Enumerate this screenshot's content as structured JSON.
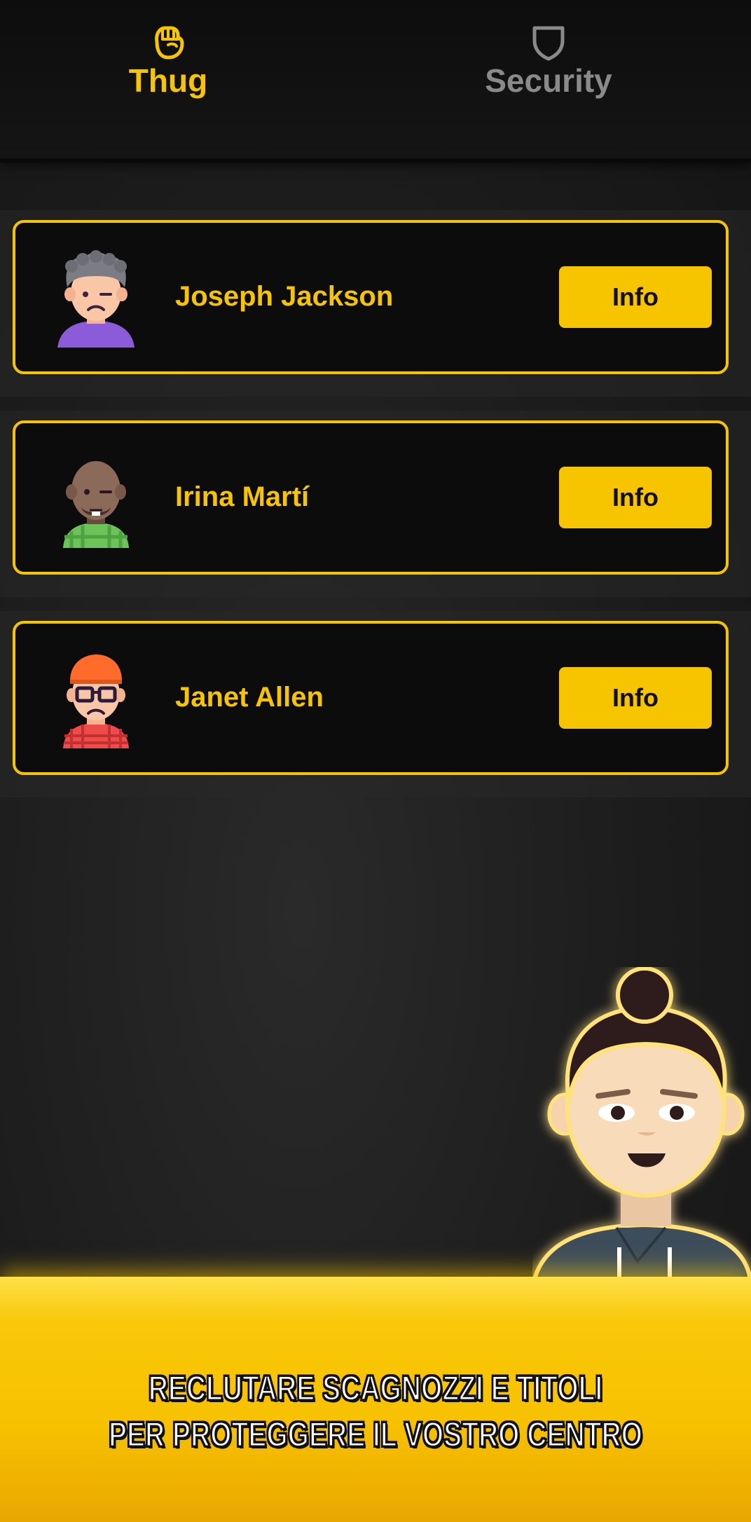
{
  "tabs": [
    {
      "label": "Thug",
      "icon": "fist-icon",
      "active": true,
      "color": "#f7c500"
    },
    {
      "label": "Security",
      "icon": "shield-icon",
      "active": false,
      "color": "#8a8a8a"
    }
  ],
  "list": {
    "items": [
      {
        "name": "Joseph Jackson",
        "button": "Info",
        "avatar": "avatar-curly-gray-hair"
      },
      {
        "name": "Irina Martí",
        "button": "Info",
        "avatar": "avatar-bald-green-shirt"
      },
      {
        "name": "Janet Allen",
        "button": "Info",
        "avatar": "avatar-orange-cap-glasses"
      }
    ]
  },
  "banner": {
    "line1": "RECLUTARE SCAGNOZZI E TITOLI",
    "line2": "PER PROTEGGERE IL VOSTRO CENTRO"
  },
  "colors": {
    "accent": "#f7c500",
    "card_bg": "#0c0c0c",
    "inactive": "#8a8a8a"
  }
}
